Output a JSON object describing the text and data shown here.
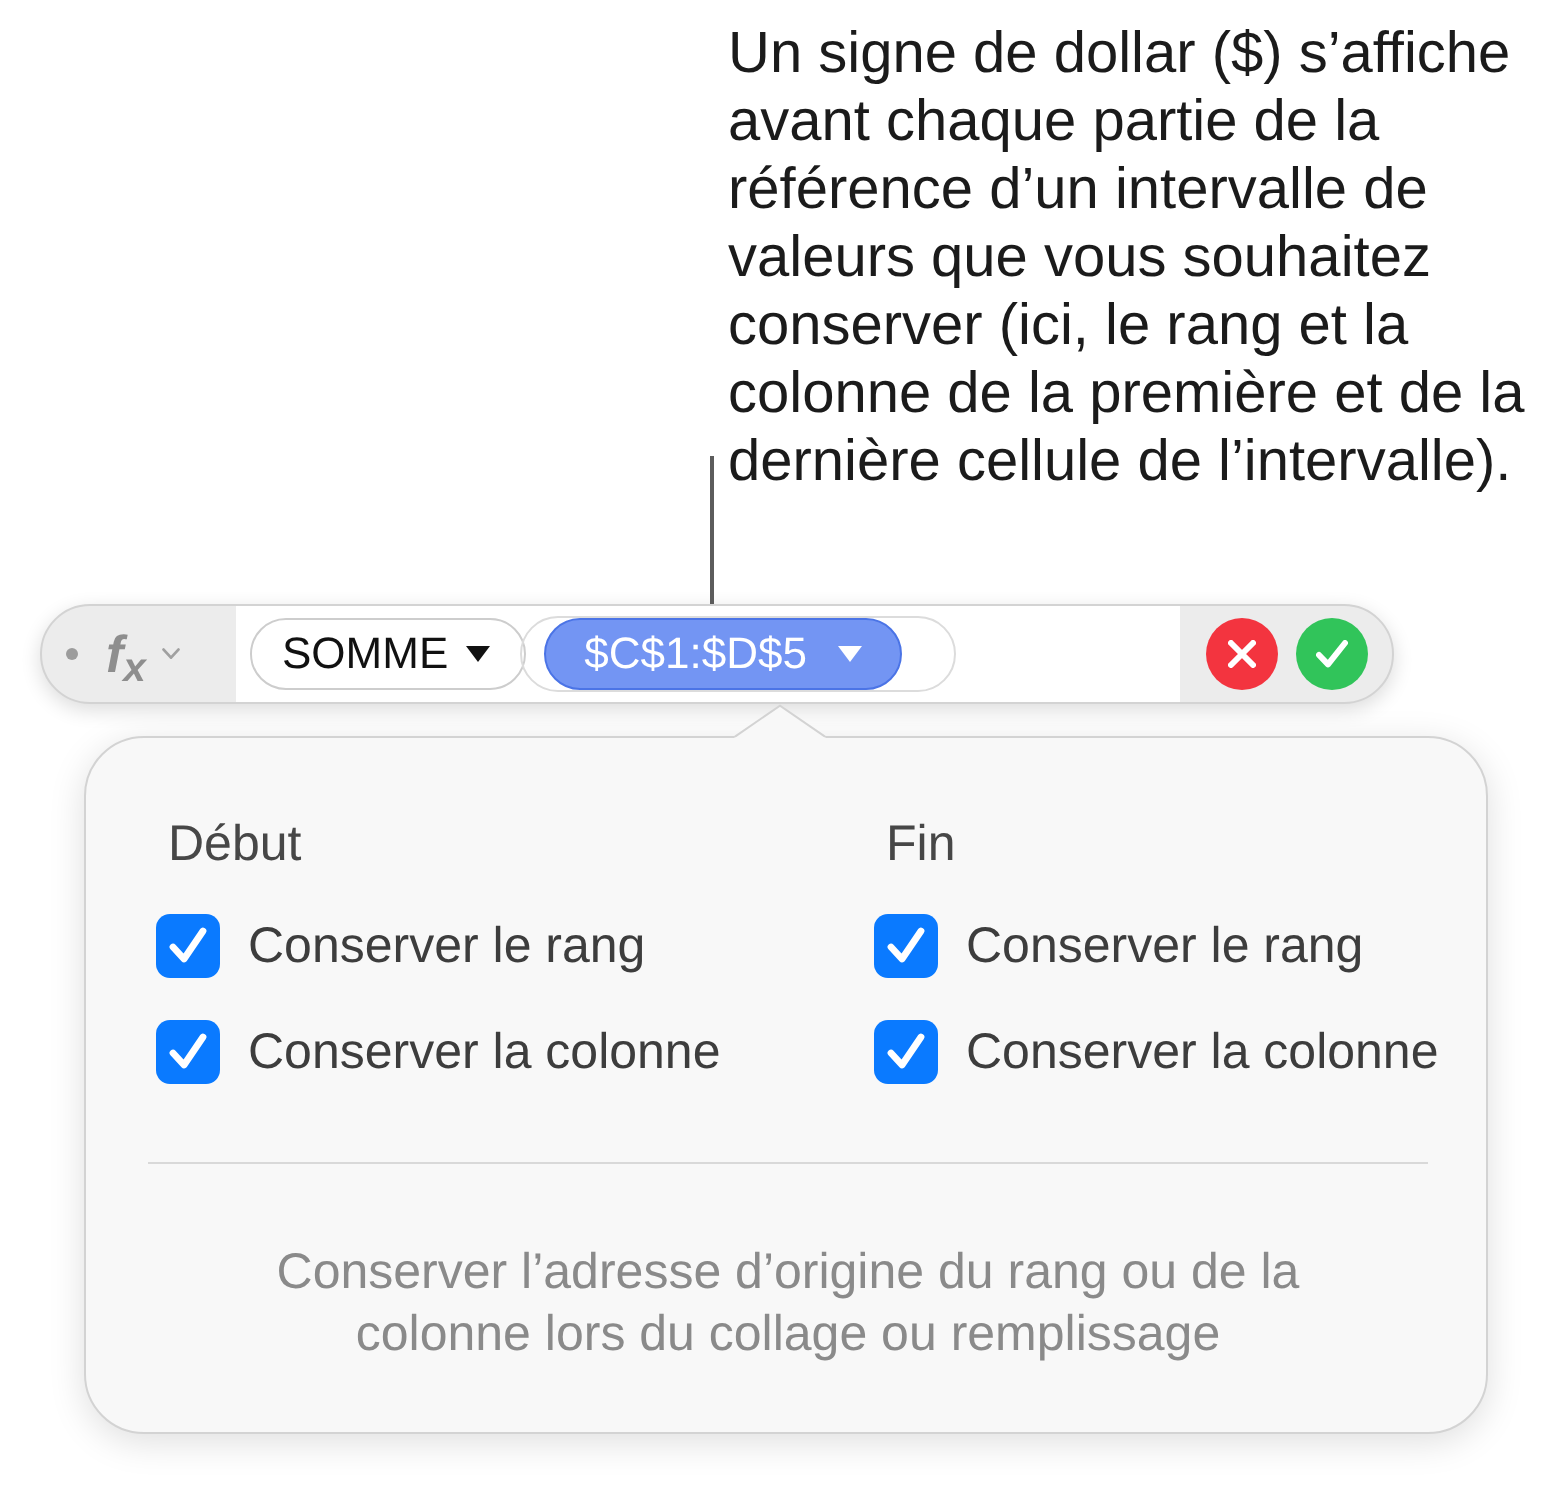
{
  "callout": {
    "text": "Un signe de dollar ($) s’affiche\navant chaque partie de la\nréférence d’un intervalle de\nvaleurs que vous souhaitez\nconserver (ici, le rang et la\ncolonne de la première et de la\ndernière cellule de l’intervalle)."
  },
  "formula_bar": {
    "function_label": "f$_{x}$",
    "tokens": [
      {
        "kind": "function",
        "text": "SOMME",
        "selected": false
      },
      {
        "kind": "reference",
        "text": "$C$1:$D$5",
        "selected": true
      }
    ]
  },
  "popover": {
    "columns": [
      {
        "heading": "Début",
        "options": [
          {
            "label": "Conserver le rang",
            "checked": true
          },
          {
            "label": "Conserver la colonne",
            "checked": true
          }
        ]
      },
      {
        "heading": "Fin",
        "options": [
          {
            "label": "Conserver le rang",
            "checked": true
          },
          {
            "label": "Conserver la colonne",
            "checked": true
          }
        ]
      }
    ],
    "note": "Conserver l’adresse d’origine du rang ou de la\ncolonne lors du collage ou remplissage"
  }
}
